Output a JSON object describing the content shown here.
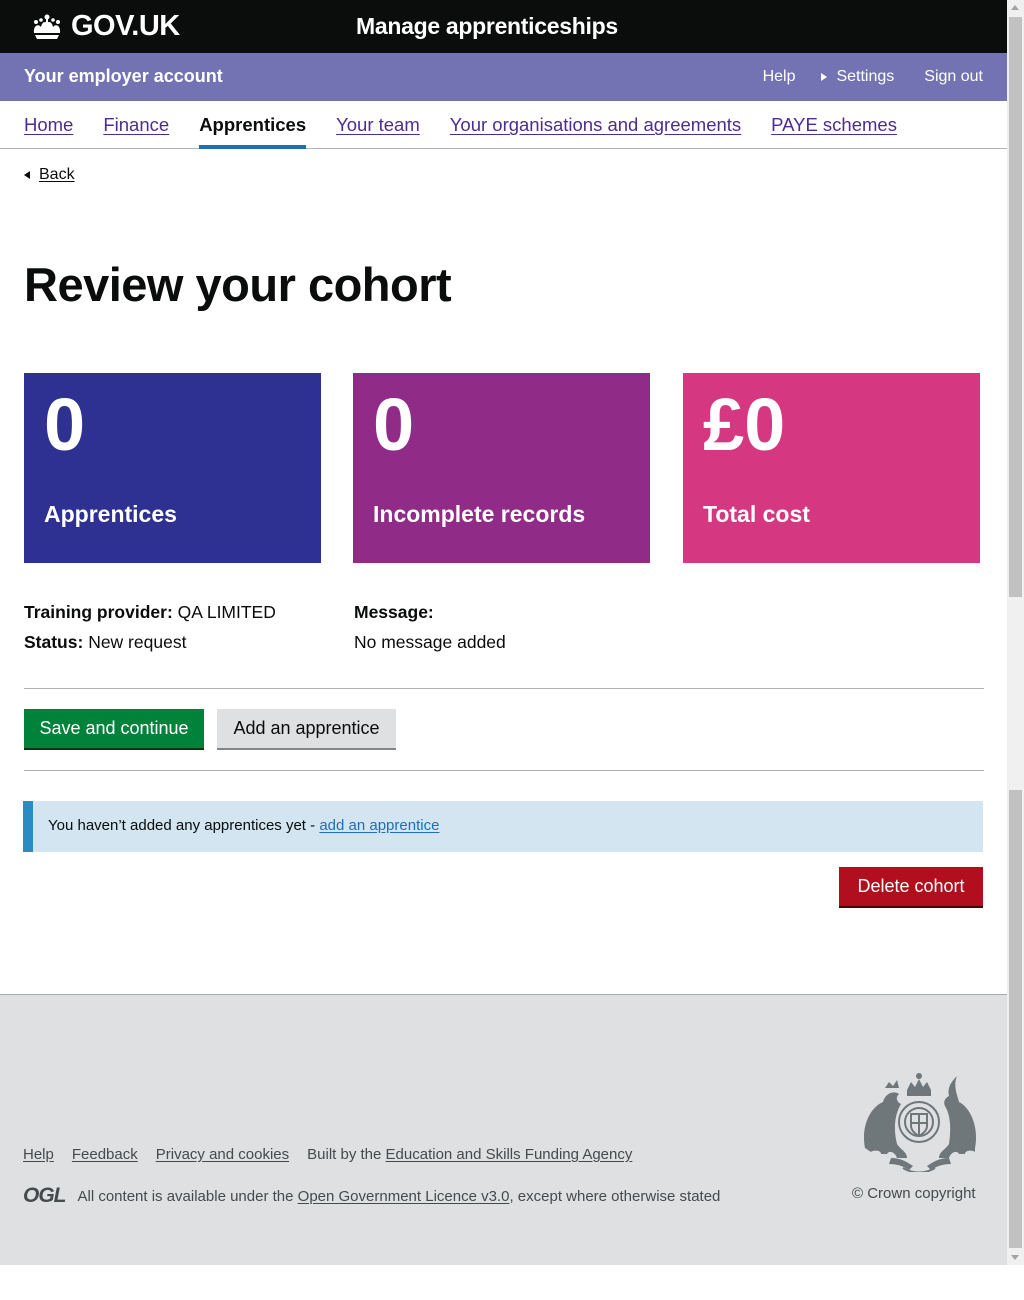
{
  "header": {
    "logo_text": "GOV.UK",
    "service_name": "Manage apprenticeships",
    "icons": {
      "logo": "crown-icon"
    }
  },
  "account_bar": {
    "title": "Your employer account",
    "help": "Help",
    "settings": "Settings",
    "sign_out": "Sign out",
    "bg_color": "#7373b3"
  },
  "nav": {
    "items": [
      {
        "label": "Home",
        "active": false
      },
      {
        "label": "Finance",
        "active": false
      },
      {
        "label": "Apprentices",
        "active": true
      },
      {
        "label": "Your team",
        "active": false
      },
      {
        "label": "Your organisations and agreements",
        "active": false
      },
      {
        "label": "PAYE schemes",
        "active": false
      }
    ]
  },
  "back_link": "Back",
  "page_title": "Review your cohort",
  "panels": [
    {
      "value": "0",
      "label": "Apprentices",
      "color": "#2e3191"
    },
    {
      "value": "0",
      "label": "Incomplete records",
      "color": "#912b88"
    },
    {
      "value": "£0",
      "label": "Total cost",
      "color": "#d53880"
    }
  ],
  "details": {
    "training_provider_label": "Training provider:",
    "training_provider_value": "QA LIMITED",
    "status_label": "Status:",
    "status_value": "New request",
    "message_label": "Message:",
    "message_value": "No message added"
  },
  "buttons": {
    "save": "Save and continue",
    "add": "Add an apprentice",
    "delete": "Delete cohort"
  },
  "notice": {
    "text": "You haven’t added any apprentices yet - ",
    "link": "add an apprentice"
  },
  "footer": {
    "links": [
      "Help",
      "Feedback",
      "Privacy and cookies"
    ],
    "built_by_prefix": "Built by the ",
    "built_by_link": "Education and Skills Funding Agency",
    "ogl": "OGL",
    "licence_prefix": "All content is available under the ",
    "licence_link": "Open Government Licence v3.0",
    "licence_suffix": ", except where otherwise stated",
    "copyright": "© Crown copyright",
    "icons": {
      "crest": "royal-coat-of-arms-icon"
    }
  }
}
